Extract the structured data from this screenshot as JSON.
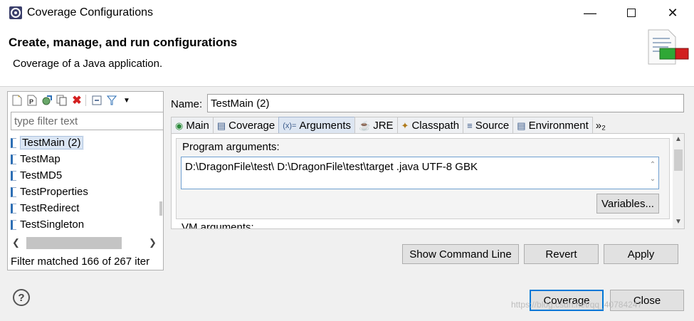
{
  "window": {
    "title": "Coverage Configurations",
    "minimize_icon": "minimize-icon",
    "maximize_icon": "maximize-icon",
    "close_icon": "close-icon"
  },
  "header": {
    "title": "Create, manage, and run configurations",
    "description": "Coverage of a Java application."
  },
  "left_panel": {
    "toolbar_icons": [
      "new-configuration-icon",
      "new-prototype-icon",
      "export-icon",
      "duplicate-icon",
      "delete-icon",
      "collapse-all-icon",
      "filter-icon",
      "view-menu-icon"
    ],
    "filter_placeholder": "type filter text",
    "items": [
      {
        "label": "TestMain (2)",
        "selected": true
      },
      {
        "label": "TestMap",
        "selected": false
      },
      {
        "label": "TestMD5",
        "selected": false
      },
      {
        "label": "TestProperties",
        "selected": false
      },
      {
        "label": "TestRedirect",
        "selected": false
      },
      {
        "label": "TestSingleton",
        "selected": false
      }
    ],
    "filter_status": "Filter matched 166 of 267 iter"
  },
  "editor": {
    "name_label": "Name:",
    "name_value": "TestMain (2)",
    "tabs": [
      {
        "label": "Main",
        "icon": "main-tab-icon",
        "active": false
      },
      {
        "label": "Coverage",
        "icon": "coverage-tab-icon",
        "active": false
      },
      {
        "label": "Arguments",
        "icon": "arguments-tab-icon",
        "active": true
      },
      {
        "label": "JRE",
        "icon": "jre-tab-icon",
        "active": false
      },
      {
        "label": "Classpath",
        "icon": "classpath-tab-icon",
        "active": false
      },
      {
        "label": "Source",
        "icon": "source-tab-icon",
        "active": false
      },
      {
        "label": "Environment",
        "icon": "environment-tab-icon",
        "active": false
      }
    ],
    "tabs_overflow": "»₂",
    "program_args_label": "Program arguments:",
    "program_args_value": "D:\\DragonFile\\test\\ D:\\DragonFile\\test\\target .java UTF-8 GBK",
    "variables_button": "Variables...",
    "vm_args_label": "VM arguments:"
  },
  "buttons": {
    "show_command_line": "Show Command Line",
    "revert": "Revert",
    "apply": "Apply",
    "coverage": "Coverage",
    "close": "Close"
  },
  "footer": {
    "help_icon": "help-icon",
    "help_glyph": "?",
    "watermark": "https://blog.csdn.net/qq_40784247"
  },
  "colors": {
    "accent": "#0078d7",
    "selection": "#dbe6f4",
    "delete_red": "#d42020"
  }
}
